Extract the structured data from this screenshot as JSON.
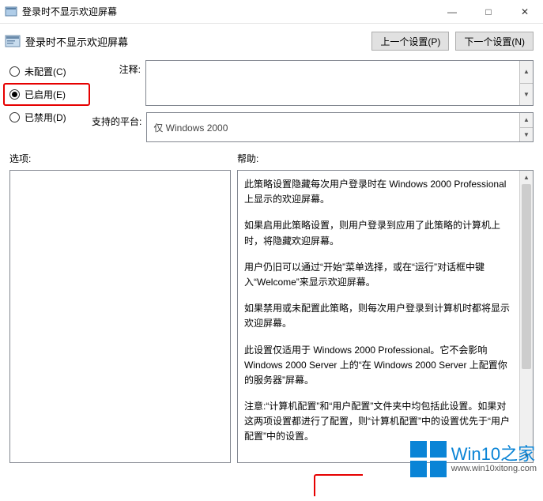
{
  "titlebar": {
    "title": "登录时不显示欢迎屏幕"
  },
  "winbuttons": {
    "minimize": "—",
    "maximize": "□",
    "close": "✕"
  },
  "header": {
    "title": "登录时不显示欢迎屏幕",
    "prev_btn": "上一个设置(P)",
    "next_btn": "下一个设置(N)"
  },
  "radios": {
    "not_configured": "未配置(C)",
    "enabled": "已启用(E)",
    "disabled": "已禁用(D)",
    "selected": "enabled"
  },
  "fields": {
    "comment_label": "注释:",
    "platform_label": "支持的平台:",
    "platform_value": "仅 Windows 2000"
  },
  "lower": {
    "options_label": "选项:",
    "help_label": "帮助:"
  },
  "help": {
    "p1": "此策略设置隐藏每次用户登录时在 Windows 2000 Professional 上显示的欢迎屏幕。",
    "p2": "如果启用此策略设置，则用户登录到应用了此策略的计算机上时，将隐藏欢迎屏幕。",
    "p3": "用户仍旧可以通过“开始”菜单选择，或在“运行”对话框中键入“Welcome”来显示欢迎屏幕。",
    "p4": "如果禁用或未配置此策略，则每次用户登录到计算机时都将显示欢迎屏幕。",
    "p5": "此设置仅适用于 Windows 2000 Professional。它不会影响 Windows 2000 Server 上的“在 Windows 2000 Server 上配置你的服务器”屏幕。",
    "p6": "注意:“计算机配置”和“用户配置”文件夹中均包括此设置。如果对这两项设置都进行了配置，则“计算机配置”中的设置优先于“用户配置”中的设置。"
  },
  "watermark": {
    "main": "Win10之家",
    "sub": "www.win10xitong.com"
  }
}
